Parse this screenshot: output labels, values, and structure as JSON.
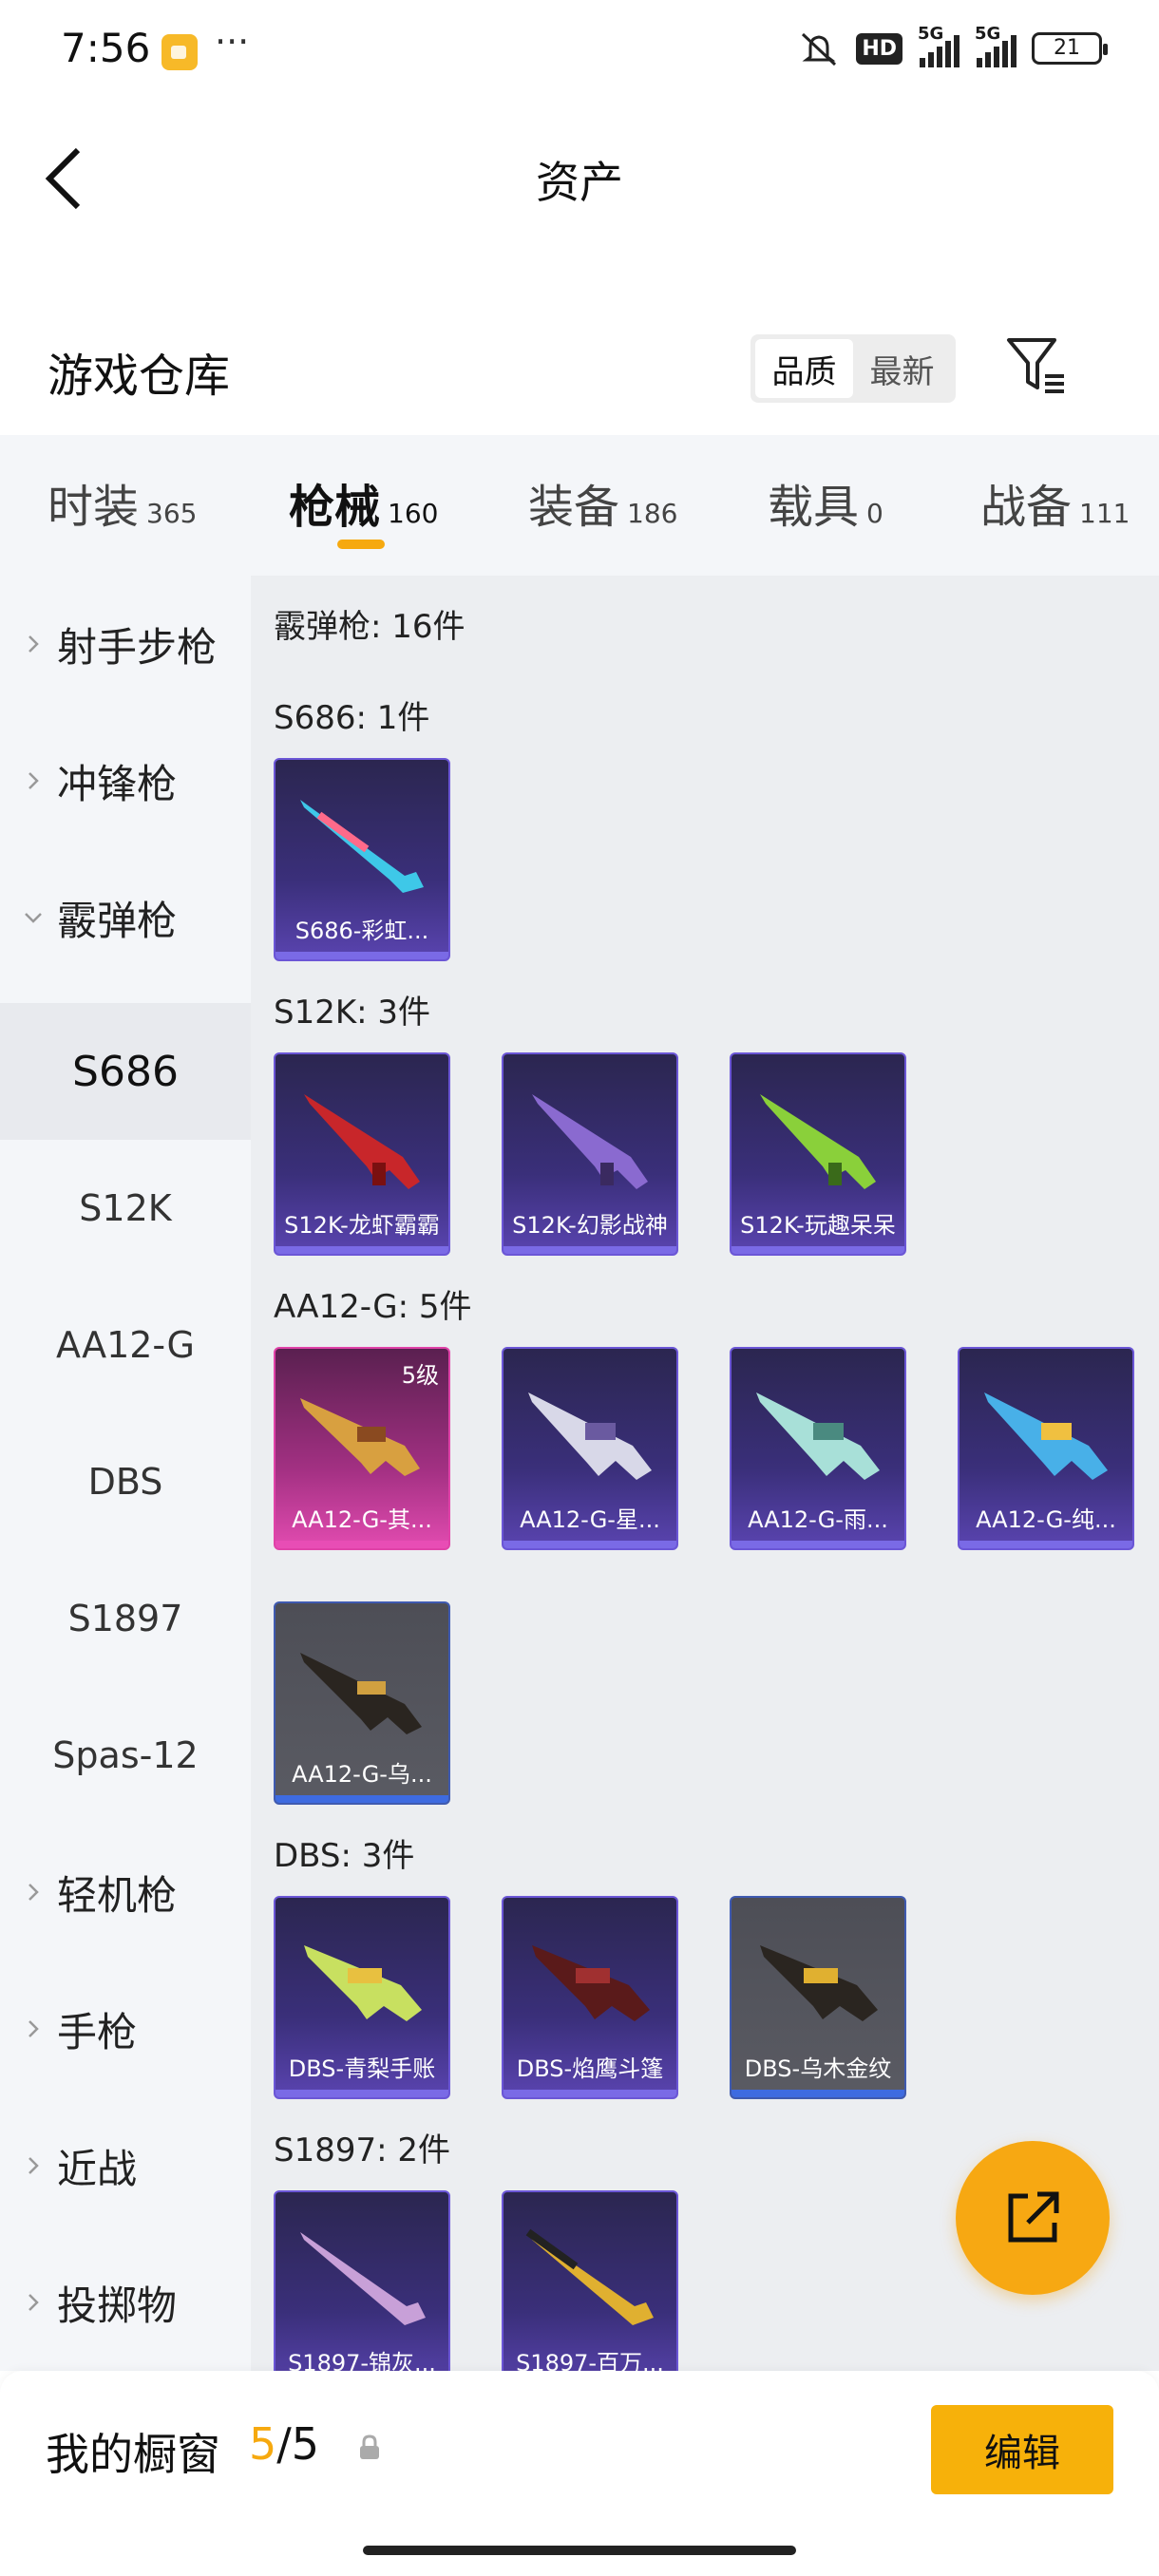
{
  "status_bar": {
    "time": "7:56",
    "dots": "···",
    "hd": "HD",
    "net1": "5G",
    "net2": "5G",
    "battery": "21"
  },
  "header": {
    "title": "资产"
  },
  "section": {
    "title": "游戏仓库",
    "sort_options": [
      "品质",
      "最新"
    ],
    "active_sort": 0
  },
  "tabs": [
    {
      "name": "时装",
      "count": "365"
    },
    {
      "name": "枪械",
      "count": "160"
    },
    {
      "name": "装备",
      "count": "186"
    },
    {
      "name": "载具",
      "count": "0"
    },
    {
      "name": "战备",
      "count": "111"
    }
  ],
  "sidebar": {
    "categories": [
      "射手步枪",
      "冲锋枪",
      "霰弹枪"
    ],
    "subitems": [
      "S686",
      "S12K",
      "AA12-G",
      "DBS",
      "S1897",
      "Spas-12"
    ],
    "more": [
      "轻机枪",
      "手枪",
      "近战",
      "投掷物"
    ]
  },
  "content": {
    "summary": "霰弹枪: 16件",
    "groups": [
      {
        "title": "S686: 1件",
        "items": [
          {
            "label": "S686-彩虹..."
          }
        ]
      },
      {
        "title": "S12K: 3件",
        "items": [
          {
            "label": "S12K-龙虾霸霸"
          },
          {
            "label": "S12K-幻影战神"
          },
          {
            "label": "S12K-玩趣呆呆"
          }
        ]
      },
      {
        "title": "AA12-G: 5件",
        "items": [
          {
            "label": "AA12-G-其...",
            "level": "5级"
          },
          {
            "label": "AA12-G-星..."
          },
          {
            "label": "AA12-G-雨..."
          },
          {
            "label": "AA12-G-纯..."
          },
          {
            "label": "AA12-G-乌..."
          }
        ]
      },
      {
        "title": "DBS: 3件",
        "items": [
          {
            "label": "DBS-青梨手账"
          },
          {
            "label": "DBS-焰鹰斗篷"
          },
          {
            "label": "DBS-乌木金纹"
          }
        ]
      },
      {
        "title": "S1897: 2件",
        "items": [
          {
            "label": "S1897-锦灰..."
          },
          {
            "label": "S1897-百万..."
          }
        ]
      }
    ]
  },
  "bottom_bar": {
    "label": "我的橱窗",
    "current": "5",
    "sep": "/",
    "max": "5",
    "edit_label": "编辑"
  },
  "colors": {
    "accent": "#f6a90f",
    "epic_purple": "#6b56d6",
    "legend_pink": "#e042a8",
    "rare_blue": "#3e6be0"
  }
}
